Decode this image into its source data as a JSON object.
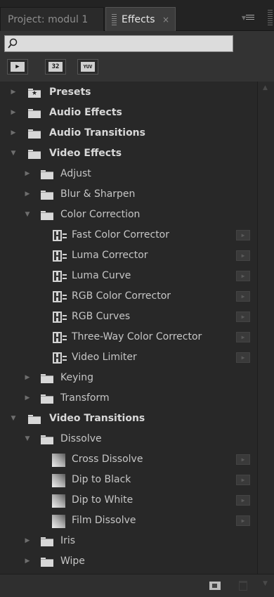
{
  "tabs": {
    "project": "Project: modul 1",
    "effects": "Effects",
    "close": "×"
  },
  "search": {
    "value": "",
    "placeholder": ""
  },
  "filters": [
    {
      "name": "accelerated-effects-filter",
      "label": ""
    },
    {
      "name": "32-bit-color-filter",
      "label": "32"
    },
    {
      "name": "yuv-filter",
      "label": "YUV"
    }
  ],
  "tree": {
    "presets": "Presets",
    "audio_effects": "Audio Effects",
    "audio_transitions": "Audio Transitions",
    "video_effects": "Video Effects",
    "adjust": "Adjust",
    "blur_sharpen": "Blur & Sharpen",
    "color_correction": "Color Correction",
    "cc_items": [
      "Fast Color Corrector",
      "Luma Corrector",
      "Luma Curve",
      "RGB Color Corrector",
      "RGB Curves",
      "Three-Way Color Corrector",
      "Video Limiter"
    ],
    "keying": "Keying",
    "transform": "Transform",
    "video_transitions": "Video Transitions",
    "dissolve": "Dissolve",
    "dissolve_items": [
      "Cross Dissolve",
      "Dip to Black",
      "Dip to White",
      "Film Dissolve"
    ],
    "iris": "Iris",
    "wipe": "Wipe"
  },
  "icons": {
    "folder": "folder-icon",
    "effect": "effect-icon",
    "transition": "transition-icon",
    "accelerated": "accelerated-badge-icon",
    "search": "search-icon",
    "new_bin": "new-bin-icon",
    "delete": "trash-icon",
    "panel_menu": "panel-menu-icon"
  },
  "colors": {
    "panel_bg": "#282828",
    "tab_active": "#3c3c3c",
    "text": "#c6c6c6"
  }
}
